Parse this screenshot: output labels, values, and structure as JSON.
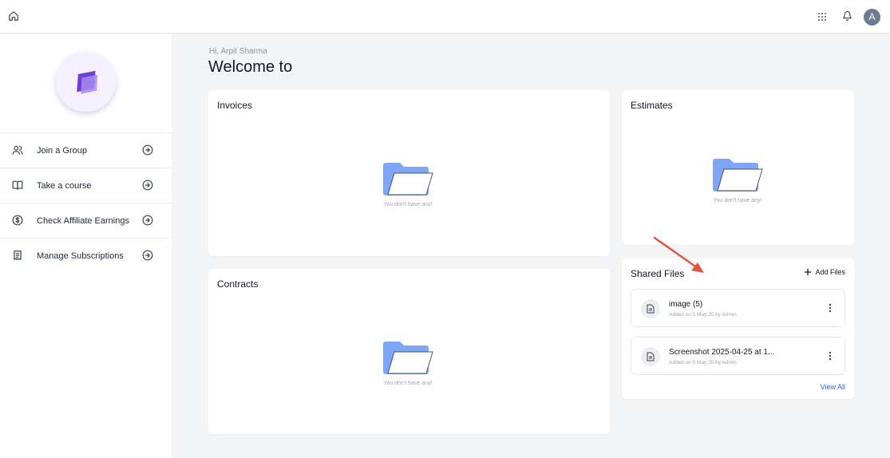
{
  "topbar": {
    "home_icon": "home-icon",
    "apps_icon": "grid-icon",
    "bell_icon": "bell-icon",
    "avatar_letter": "A",
    "avatar_color": "#6b7c8f"
  },
  "sidebar": {
    "items": [
      {
        "label": "Join a Group",
        "icon": "users-icon"
      },
      {
        "label": "Take a course",
        "icon": "book-icon"
      },
      {
        "label": "Check Affiliate Earnings",
        "icon": "dollar-icon"
      },
      {
        "label": "Manage Subscriptions",
        "icon": "receipt-icon"
      }
    ]
  },
  "main": {
    "greeting": "Hi, Arpit Sharma",
    "welcome": "Welcome to",
    "invoices": {
      "title": "Invoices",
      "empty_text": "You don't have any!"
    },
    "contracts": {
      "title": "Contracts",
      "empty_text": "You don't have any!"
    },
    "estimates": {
      "title": "Estimates",
      "empty_text": "You don't have any!"
    },
    "shared_files": {
      "title": "Shared Files",
      "add_label": "Add Files",
      "files": [
        {
          "name": "image (5)",
          "meta": "Added on 5 May 25 by Admin"
        },
        {
          "name": "Screenshot 2025-04-25 at 1...",
          "meta": "Added on 5 May 25 by Admin"
        }
      ],
      "view_all": "View All"
    }
  },
  "colors": {
    "accent_blue": "#2563eb",
    "folder_blue": "#7ea6f7",
    "annotation_arrow": "#e5533d",
    "logo_purple": "#7c4ddb"
  }
}
